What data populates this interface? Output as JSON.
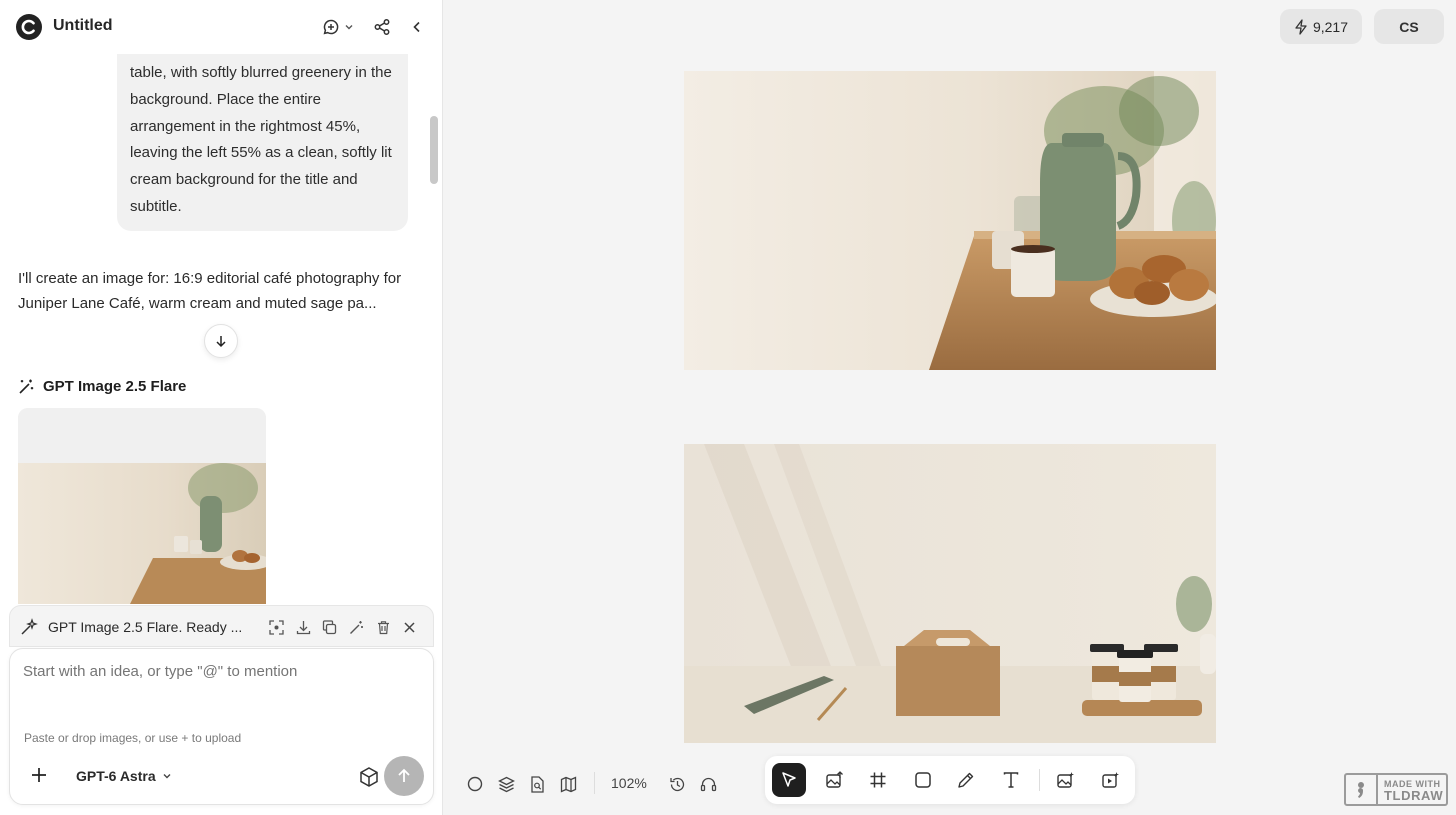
{
  "header": {
    "title": "Untitled"
  },
  "chat": {
    "user_message": "table, with softly blurred greenery in the background. Place the entire arrangement in the rightmost 45%, leaving the left 55% as a clean, softly lit cream background for the title and subtitle.",
    "assistant_message": "I'll create an image for: 16:9 editorial café photography for Juniper Lane Café, warm cream and muted sage pa...",
    "generation_title": "GPT Image 2.5 Flare"
  },
  "status": {
    "text": "GPT Image 2.5 Flare. Ready ..."
  },
  "composer": {
    "placeholder": "Start with an idea, or type \"@\" to mention",
    "hint": "Paste or drop images, or use + to upload",
    "model": "GPT-6 Astra"
  },
  "topbar": {
    "credits": "9,217",
    "user_initials": "CS"
  },
  "canvas_toolbar": {
    "zoom": "102%"
  },
  "badge": {
    "line1": "MADE WITH",
    "line2": "TLDRAW"
  },
  "colors": {
    "accent": "#1f1f1f",
    "sage": "#7c8f72",
    "cream": "#efe8dc",
    "wood": "#b98a57"
  }
}
